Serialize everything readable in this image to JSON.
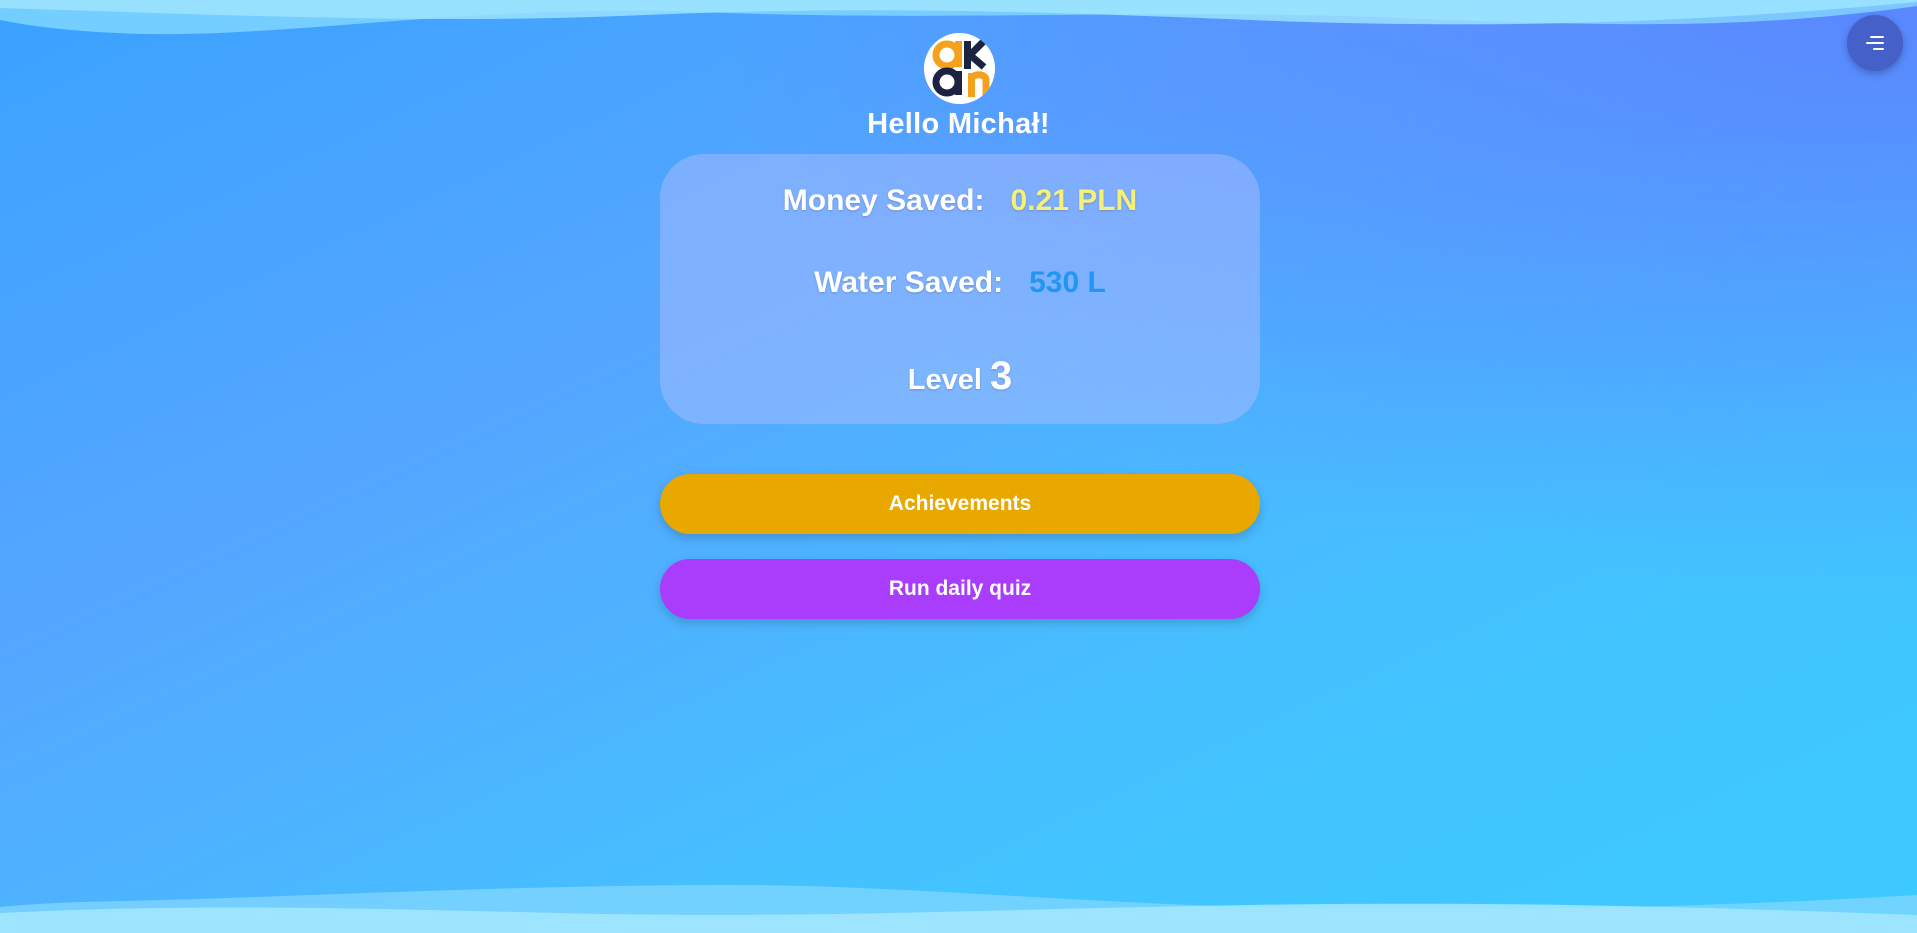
{
  "header": {
    "greeting": "Hello Michał!",
    "logo_icon": "logo-icon",
    "menu_icon": "menu-icon"
  },
  "stats": {
    "money_label": "Money Saved:",
    "money_value": "0.21 PLN",
    "water_label": "Water Saved:",
    "water_value": "530 L",
    "level_label": "Level",
    "level_value": "3"
  },
  "actions": {
    "achievements_label": "Achievements",
    "quiz_label": "Run daily quiz"
  },
  "colors": {
    "background_start": "#3aa2ff",
    "background_end": "#3ccaff",
    "menu_button": "#4660c9",
    "money_value": "#f6f176",
    "water_value": "#2196f3",
    "achievements_button": "#e8a800",
    "quiz_button": "#aa3cfb",
    "logo_orange": "#f5a11c",
    "logo_navy": "#1b2340"
  }
}
